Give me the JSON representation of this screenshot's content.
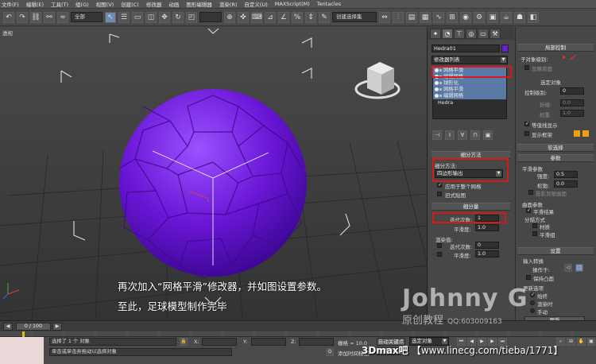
{
  "menu": [
    "文件(F)",
    "编辑(E)",
    "工具(T)",
    "组(G)",
    "视图(V)",
    "创建(C)",
    "修改器",
    "动画",
    "图形编辑器",
    "渲染(R)",
    "自定义(U)",
    "MAXScript(M)",
    "Tentacles"
  ],
  "toolbar": {
    "filter_select": "全部",
    "named_selection": "创建选择集"
  },
  "viewport": {
    "label": "透视",
    "caption_line1": "再次加入“网格平滑”修改器，并如图设置参数。",
    "caption_line2": "至此，足球模型制作完毕"
  },
  "watermark": {
    "name": "Johnny G",
    "subtitle": "原创教程",
    "qq": "QQ:603009163",
    "site": "3Dmax吧",
    "url": "【www.linecg.com/tieba/1771】"
  },
  "command_panel": {
    "object_name": "Hedra01",
    "modifier_list_label": "修改器列表",
    "stack_items": [
      {
        "label": "网格平滑",
        "highlighted": true
      },
      {
        "label": "编辑网格",
        "highlighted": true
      },
      {
        "label": "球形化",
        "highlighted": true
      },
      {
        "label": "网格平滑",
        "highlighted": true
      },
      {
        "label": "编辑网格",
        "highlighted": true
      },
      {
        "label": "Hedra",
        "highlighted": false
      }
    ],
    "subdivision_method": {
      "header": "细分方法",
      "label": "细分方法:",
      "value": "四边形输出",
      "apply_whole_mesh": "应用于整个网格",
      "old_style": "旧式贴图"
    },
    "subdivision_amount": {
      "header": "细分量",
      "iterations_label": "迭代次数:",
      "iterations_value": "1",
      "smoothness_label": "平滑度:",
      "smoothness_value": "1.0",
      "render_label": "渲染值:",
      "render_iterations_label": "迭代次数:",
      "render_iterations_value": "0",
      "render_smoothness_label": "平滑度:",
      "render_smoothness_value": "1.0"
    }
  },
  "right_panel": {
    "local_control": {
      "header": "局部控制",
      "sublevel_label": "子对象级别:",
      "ignore_back": "忽略背面",
      "select_object": "选定对象",
      "control_level_label": "控制级别:",
      "control_level_value": "0",
      "crease_label": "折缝:",
      "crease_value": "0.0",
      "weight_label": "权重:",
      "weight_value": "1.0",
      "isoline_display": "等值线显示",
      "show_cage": "显示框架"
    },
    "soft_selection": {
      "header": "软选择"
    },
    "parameters": {
      "header": "参数",
      "smooth_params": "平滑参数",
      "strength_label": "强度:",
      "strength_value": "0.5",
      "relax_label": "松弛:",
      "relax_value": "0.0",
      "project_to_limit": "投影到限曲面",
      "surface_params": "曲面参数",
      "smooth_result": "平滑结果",
      "separate_by": "分隔方式",
      "materials": "材质",
      "smoothing_groups": "平滑组"
    },
    "settings": {
      "header": "设置",
      "input_conversion": "输入转换",
      "operate_on": "操作于:",
      "keep_convex": "保持凸面",
      "update_options": "更新选项",
      "always": "始终",
      "when_rendering": "渲染时",
      "manually": "手动",
      "update_button": "更新"
    }
  },
  "timeline": {
    "frame": "0 / 100"
  },
  "status": {
    "selected": "选择了 1 个 对象",
    "prompt": "单击或单击并拖动以选择对象",
    "x_label": "X:",
    "y_label": "Y:",
    "z_label": "Z:",
    "grid_label": "栅格 = 10.0",
    "auto_key": "自动关键点",
    "set_key": "设置关键点",
    "selected_dropdown": "选定对象",
    "add_time_tag": "添加时间标记"
  }
}
